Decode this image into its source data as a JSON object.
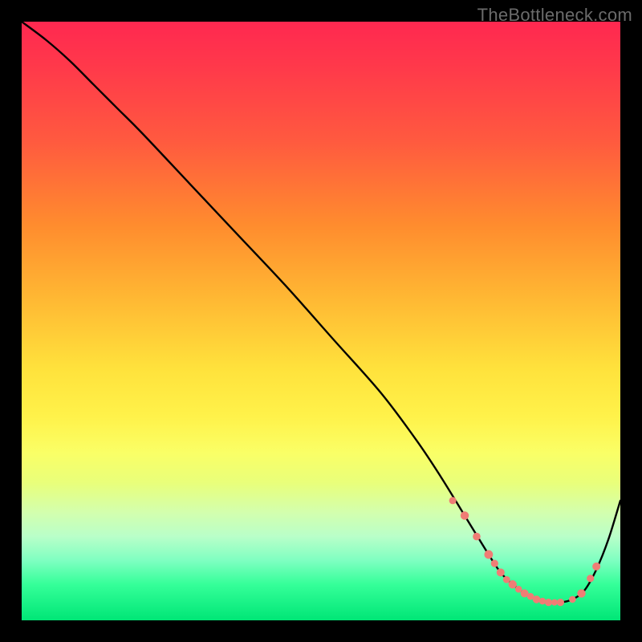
{
  "watermark": "TheBottleneck.com",
  "colors": {
    "curve": "#000000",
    "marker": "#ef7d75",
    "marker_stroke": "#000000"
  },
  "chart_data": {
    "type": "line",
    "title": "",
    "xlabel": "",
    "ylabel": "",
    "xlim": [
      0,
      100
    ],
    "ylim": [
      0,
      100
    ],
    "grid": false,
    "legend": false,
    "series": [
      {
        "name": "bottleneck-curve",
        "x": [
          0,
          4,
          8,
          12,
          16,
          20,
          28,
          36,
          44,
          52,
          60,
          66,
          70,
          74,
          78,
          80,
          82,
          84,
          86,
          88,
          90,
          92,
          94,
          96,
          98,
          100
        ],
        "y": [
          100,
          97,
          93.5,
          89.5,
          85.5,
          81.5,
          73,
          64.5,
          56,
          47,
          38,
          30,
          24,
          17.5,
          11,
          8,
          6,
          4.5,
          3.5,
          3,
          3,
          3.5,
          5,
          8.5,
          13.5,
          20
        ]
      }
    ],
    "markers": {
      "name": "highlight-points",
      "color": "#ef7d75",
      "points": [
        {
          "x": 72,
          "y": 20,
          "r": 4.5
        },
        {
          "x": 74,
          "y": 17.5,
          "r": 5.2
        },
        {
          "x": 76,
          "y": 14,
          "r": 4.8
        },
        {
          "x": 78,
          "y": 11,
          "r": 5.4
        },
        {
          "x": 79,
          "y": 9.5,
          "r": 4.6
        },
        {
          "x": 80,
          "y": 8,
          "r": 5.0
        },
        {
          "x": 81,
          "y": 6.8,
          "r": 4.4
        },
        {
          "x": 82,
          "y": 6,
          "r": 5.2
        },
        {
          "x": 83,
          "y": 5.2,
          "r": 4.3
        },
        {
          "x": 84,
          "y": 4.5,
          "r": 5.0
        },
        {
          "x": 85,
          "y": 4,
          "r": 4.3
        },
        {
          "x": 86,
          "y": 3.5,
          "r": 4.8
        },
        {
          "x": 87,
          "y": 3.2,
          "r": 4.2
        },
        {
          "x": 88,
          "y": 3,
          "r": 4.6
        },
        {
          "x": 89,
          "y": 3,
          "r": 4.0
        },
        {
          "x": 90,
          "y": 3,
          "r": 4.6
        },
        {
          "x": 92,
          "y": 3.5,
          "r": 4.3
        },
        {
          "x": 93.5,
          "y": 4.5,
          "r": 5.2
        },
        {
          "x": 95,
          "y": 7,
          "r": 4.6
        },
        {
          "x": 96,
          "y": 9,
          "r": 5.0
        }
      ]
    }
  }
}
